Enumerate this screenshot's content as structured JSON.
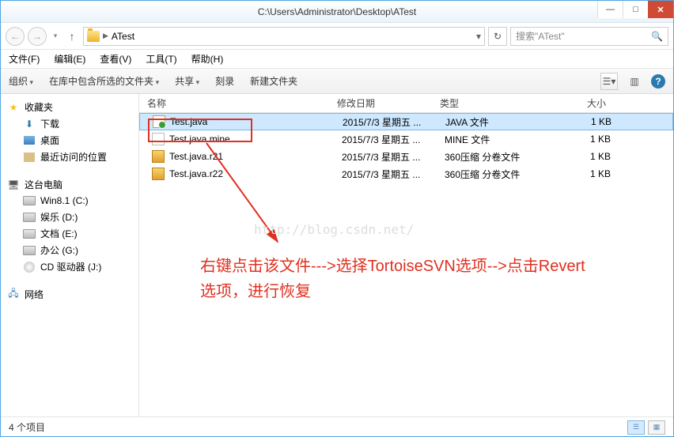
{
  "window": {
    "title": "C:\\Users\\Administrator\\Desktop\\ATest"
  },
  "address": {
    "folder": "ATest",
    "search_placeholder": "搜索\"ATest\""
  },
  "menu": {
    "file": "文件(F)",
    "edit": "编辑(E)",
    "view": "查看(V)",
    "tools": "工具(T)",
    "help": "帮助(H)"
  },
  "toolbar": {
    "organize": "组织",
    "include": "在库中包含所选的文件夹",
    "share": "共享",
    "burn": "刻录",
    "newfolder": "新建文件夹"
  },
  "sidebar": {
    "favorites": "收藏夹",
    "downloads": "下载",
    "desktop": "桌面",
    "recent": "最近访问的位置",
    "thispc": "这台电脑",
    "drives": [
      {
        "label": "Win8.1 (C:)"
      },
      {
        "label": "娱乐 (D:)"
      },
      {
        "label": "文档 (E:)"
      },
      {
        "label": "办公 (G:)"
      },
      {
        "label": "CD 驱动器 (J:)"
      }
    ],
    "network": "网络"
  },
  "columns": {
    "name": "名称",
    "date": "修改日期",
    "type": "类型",
    "size": "大小"
  },
  "files": [
    {
      "name": "Test.java",
      "date": "2015/7/3 星期五 ...",
      "type": "JAVA 文件",
      "size": "1 KB",
      "icon": "java",
      "selected": true
    },
    {
      "name": "Test.java.mine",
      "date": "2015/7/3 星期五 ...",
      "type": "MINE 文件",
      "size": "1 KB",
      "icon": "txt",
      "selected": false
    },
    {
      "name": "Test.java.r21",
      "date": "2015/7/3 星期五 ...",
      "type": "360压缩 分卷文件",
      "size": "1 KB",
      "icon": "zip",
      "selected": false
    },
    {
      "name": "Test.java.r22",
      "date": "2015/7/3 星期五 ...",
      "type": "360压缩 分卷文件",
      "size": "1 KB",
      "icon": "zip",
      "selected": false
    }
  ],
  "status": {
    "count": "4 个项目"
  },
  "annotation": {
    "line1": "右键点击该文件--->选择TortoiseSVN选项-->点击Revert",
    "line2": "选项，进行恢复",
    "watermark": "http://blog.csdn.net/"
  }
}
